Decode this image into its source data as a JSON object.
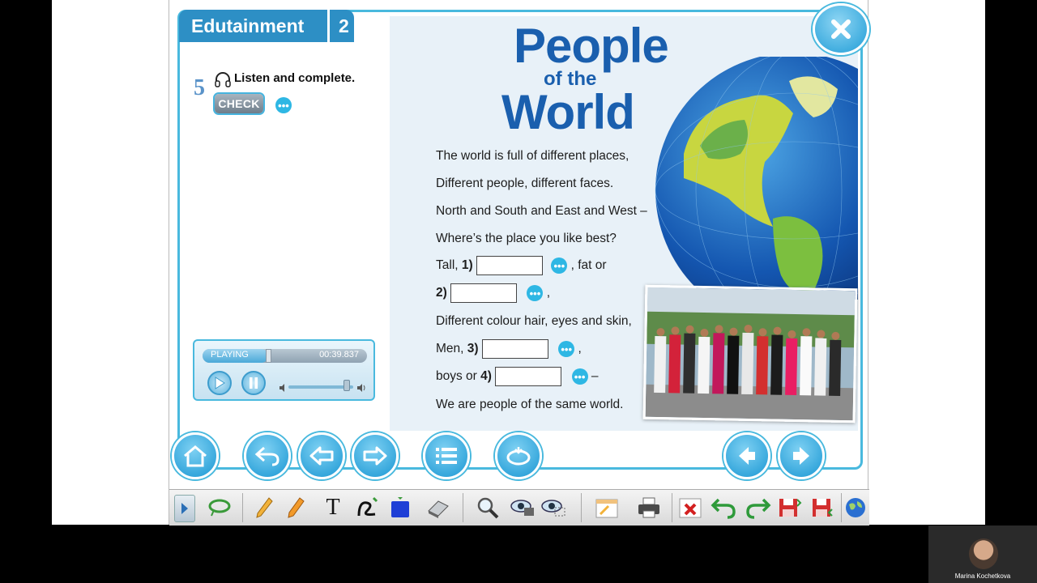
{
  "unit": {
    "title": "Edutainment",
    "number": "2"
  },
  "exercise": {
    "number": "5",
    "instruction": "Listen and complete.",
    "check_label": "CHECK"
  },
  "dots_glyph": "•••",
  "player": {
    "status": "PLAYING",
    "time": "00:39.837",
    "progress": 0.4,
    "volume": 0.9
  },
  "song": {
    "title_top": "People",
    "title_mid": "of the",
    "title_bottom": "World",
    "line1": "The world is full of different places,",
    "line2": "Different people, different faces.",
    "line3": "North and South and East and West –",
    "line4": "Where’s the place you like best?",
    "line5_pre": "Tall,",
    "n1": "1)",
    "line5_post": ", fat or",
    "n2": "2)",
    "line6_post": ",",
    "line7": "Different colour hair, eyes and skin,",
    "line8_pre": "Men,",
    "n3": "3)",
    "line8_post": ",",
    "line9_pre": "boys or",
    "n4": "4)",
    "line9_post": "–",
    "line10": "We are people of the same world."
  },
  "camera": {
    "name": "Marina Kochetkova"
  },
  "colors": {
    "accent": "#49b9de",
    "title_blue": "#1a5fae",
    "unit_tab": "#2d8fc5"
  }
}
